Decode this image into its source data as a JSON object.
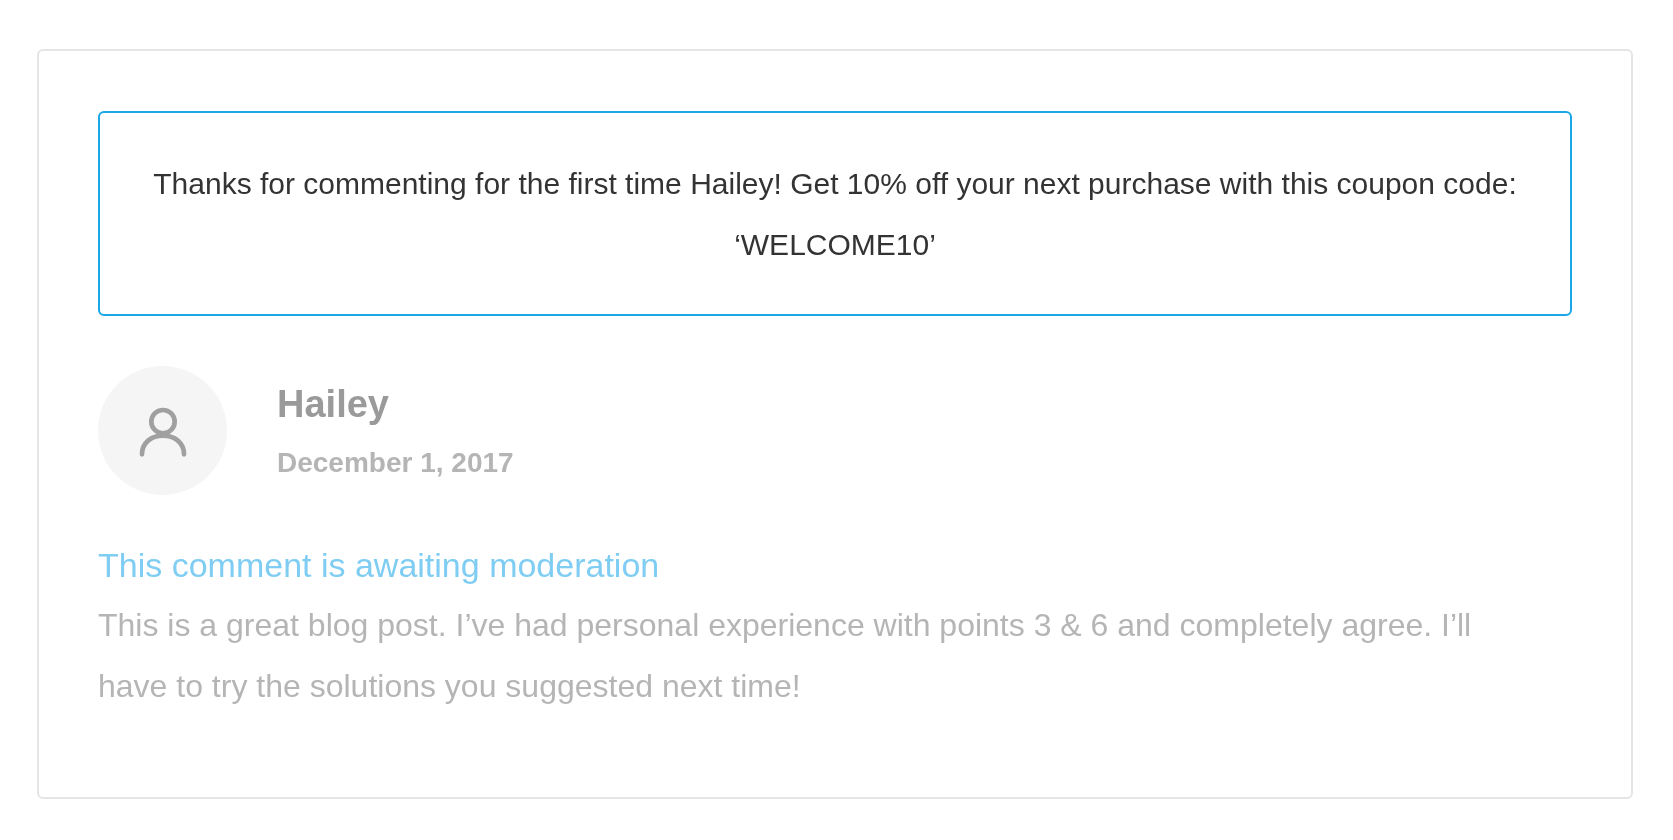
{
  "notice": {
    "text": "Thanks for commenting for the first time Hailey! Get 10% off your next purchase with this coupon code: ‘WELCOME10’"
  },
  "comment": {
    "author": "Hailey",
    "date": "December 1, 2017",
    "status": "This comment is awaiting moderation",
    "body": "This is a great blog post. I’ve had personal experience with points 3 & 6 and completely agree. I’ll have to try the solutions you suggested next time!"
  }
}
